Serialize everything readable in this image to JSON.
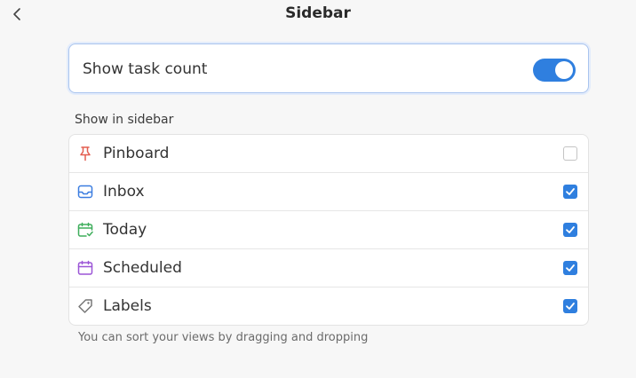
{
  "header": {
    "title": "Sidebar"
  },
  "toggle": {
    "label": "Show task count",
    "on": true
  },
  "section": {
    "label": "Show in sidebar"
  },
  "items": [
    {
      "label": "Pinboard",
      "icon": "pin-icon",
      "color": "#e35d4f",
      "checked": false
    },
    {
      "label": "Inbox",
      "icon": "inbox-icon",
      "color": "#3b7de0",
      "checked": true
    },
    {
      "label": "Today",
      "icon": "calendar-check-icon",
      "color": "#3fae5c",
      "checked": true
    },
    {
      "label": "Scheduled",
      "icon": "calendar-icon",
      "color": "#9b55d6",
      "checked": true
    },
    {
      "label": "Labels",
      "icon": "tag-icon",
      "color": "#777777",
      "checked": true
    }
  ],
  "footer": {
    "hint": "You can sort your views by dragging and dropping"
  },
  "colors": {
    "accent": "#2f7fdf",
    "background": "#f7f7f7"
  }
}
